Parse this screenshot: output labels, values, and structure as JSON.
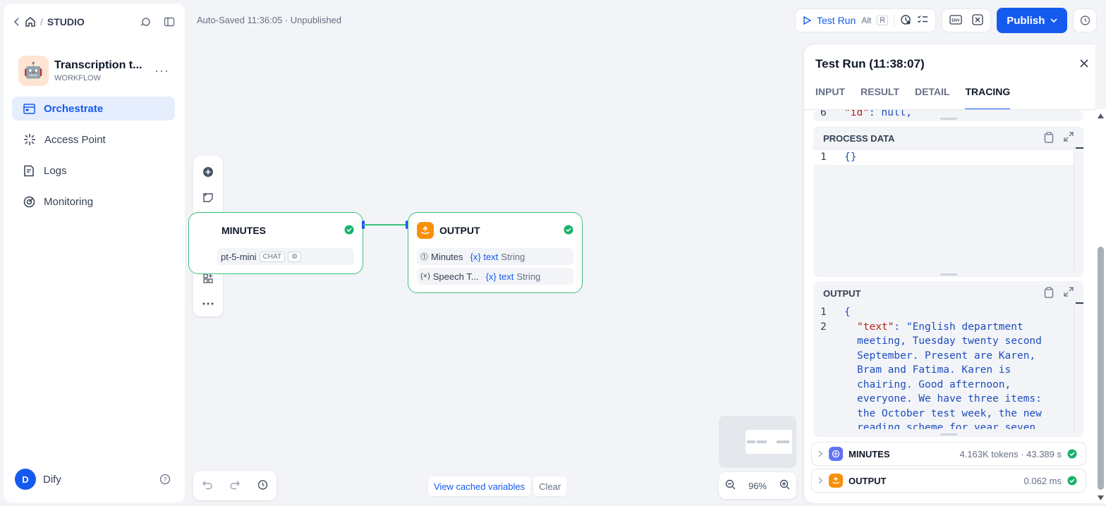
{
  "sidebar": {
    "breadcrumb": "STUDIO",
    "app": {
      "title": "Transcription t...",
      "type": "WORKFLOW",
      "emoji": "🤖"
    },
    "nav": [
      {
        "label": "Orchestrate",
        "icon": "orchestrate-icon",
        "active": true
      },
      {
        "label": "Access Point",
        "icon": "access-point-icon"
      },
      {
        "label": "Logs",
        "icon": "logs-icon"
      },
      {
        "label": "Monitoring",
        "icon": "monitoring-icon"
      }
    ],
    "user": {
      "initial": "D",
      "name": "Dify"
    }
  },
  "canvas": {
    "autosave": "Auto-Saved 11:36:05 · Unpublished",
    "nodes": {
      "minutes": {
        "title": "MINUTES",
        "model": "pt-5-mini",
        "chip": "CHAT"
      },
      "output": {
        "title": "OUTPUT",
        "rows": [
          {
            "name": "Minutes",
            "var": "{x} text",
            "type": "String"
          },
          {
            "name": "Speech T...",
            "var": "{x} text",
            "type": "String"
          }
        ]
      }
    },
    "view_cached": "View cached variables",
    "clear": "Clear",
    "zoom": "96%"
  },
  "topbar": {
    "test_run": "Test Run",
    "shortcut_alt": "Alt",
    "shortcut_r": "R",
    "publish": "Publish"
  },
  "panel": {
    "title": "Test Run (11:38:07)",
    "tabs": [
      "INPUT",
      "RESULT",
      "DETAIL",
      "TRACING"
    ],
    "active_tab": "TRACING",
    "top_snippet": {
      "ln": "6",
      "key": "\"id\"",
      "rest": ": null,"
    },
    "process_data": {
      "label": "PROCESS DATA",
      "ln": "1",
      "code": "{}"
    },
    "output": {
      "label": "OUTPUT",
      "line1": {
        "ln": "1",
        "code": "{"
      },
      "line2": {
        "ln": "2",
        "key": "\"text\"",
        "value": ": \"English department meeting, Tuesday twenty second September. Present are Karen, Bram and Fatima. Karen is chairing. Good afternoon, everyone. We have three items: the October test week, the new reading scheme for year seven"
      }
    },
    "trace": [
      {
        "name": "MINUTES",
        "meta": "4.163K tokens · 43.389 s",
        "color": "#6172f3"
      },
      {
        "name": "OUTPUT",
        "meta": "0.062 ms",
        "color": "#f79009"
      }
    ]
  },
  "colors": {
    "accent": "#155aef",
    "success": "#17b26a",
    "edge": "#3ec27a"
  }
}
